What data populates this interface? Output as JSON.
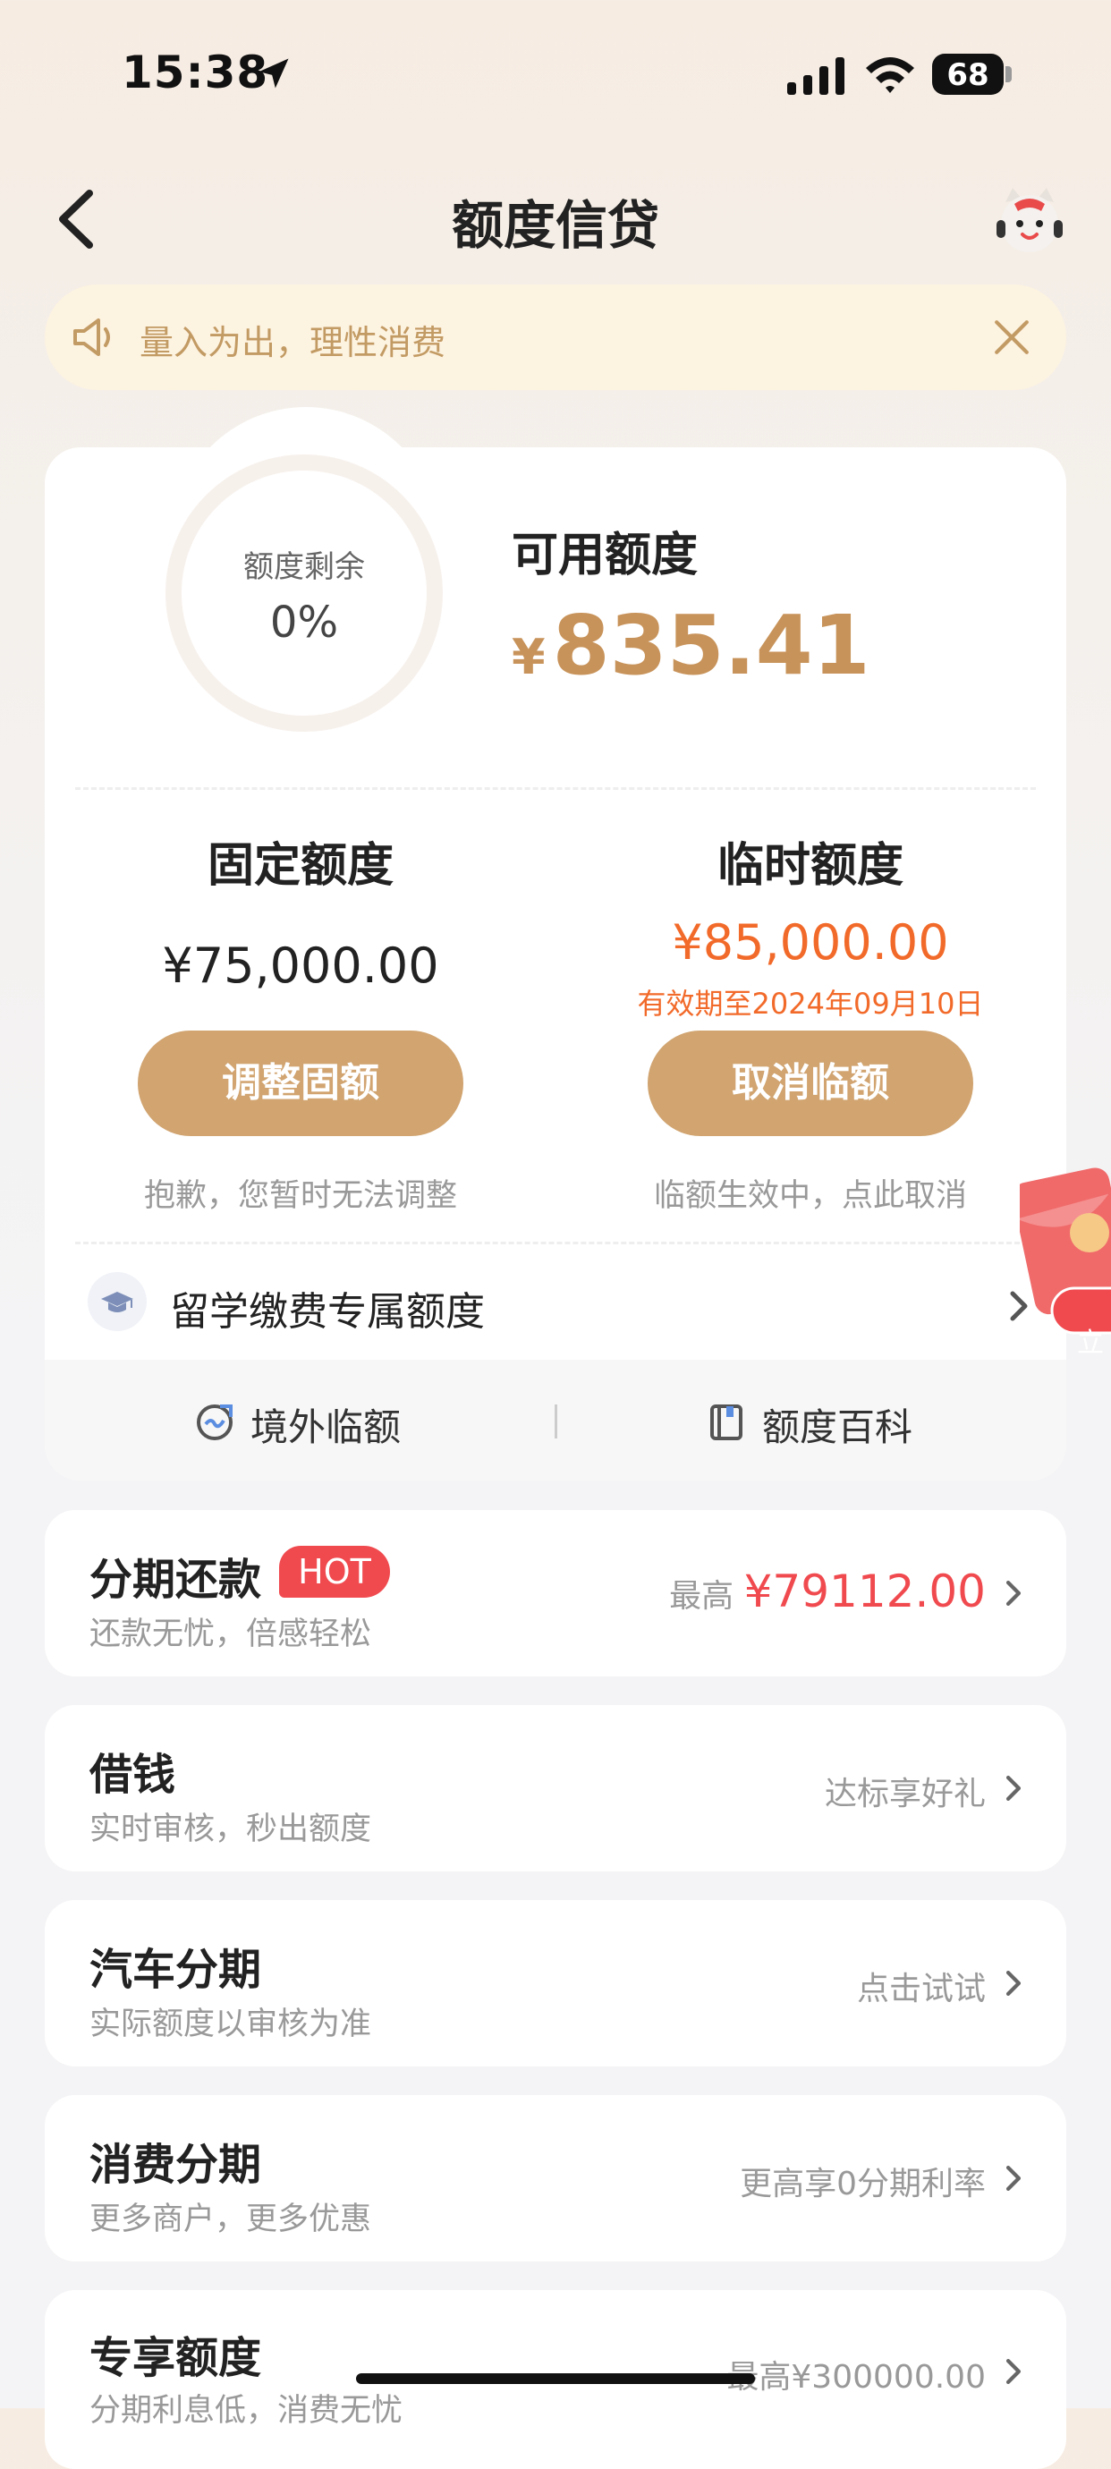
{
  "status_bar": {
    "time": "15:38",
    "battery": "68"
  },
  "nav": {
    "title": "额度信贷"
  },
  "notice": {
    "text": "量入为出，理性消费"
  },
  "credit": {
    "ring_label": "额度剩余",
    "ring_value": "0%",
    "ring_percent": 0,
    "available_title": "可用额度",
    "available_currency": "¥",
    "available_amount": "835.41",
    "fixed_title": "固定额度",
    "fixed_amount": "¥75,000.00",
    "fixed_button": "调整固额",
    "fixed_hint": "抱歉，您暂时无法调整",
    "temp_title": "临时额度",
    "temp_amount": "¥85,000.00",
    "temp_expire": "有效期至2024年09月10日",
    "temp_button": "取消临额",
    "temp_hint": "临额生效中，点此取消",
    "study_label": "留学缴费专属额度",
    "overseas_label": "境外临额",
    "encyclopedia_label": "额度百科"
  },
  "envelope": {
    "text": "立"
  },
  "products": [
    {
      "title": "分期还款",
      "badge": "HOT",
      "subtitle": "还款无忧，倍感轻松",
      "right_prefix": "最高 ",
      "right_value": "¥79112.00"
    },
    {
      "title": "借钱",
      "subtitle": "实时审核，秒出额度",
      "right": "达标享好礼"
    },
    {
      "title": "汽车分期",
      "subtitle": "实际额度以审核为准",
      "right": "点击试试"
    },
    {
      "title": "消费分期",
      "subtitle": "更多商户，更多优惠",
      "right": "更高享0分期利率"
    },
    {
      "title": "专享额度",
      "subtitle": "分期利息低，消费无忧",
      "right": "最高¥300000.00"
    }
  ],
  "colors": {
    "accent": "#d1a470",
    "amount_gold": "#c8935a",
    "orange": "#f26a2a",
    "hot_red": "#f04a4f"
  }
}
